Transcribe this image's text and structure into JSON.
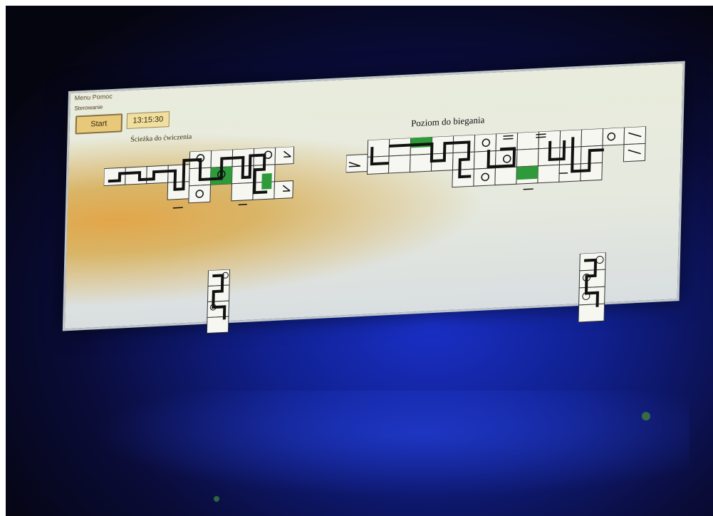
{
  "window": {
    "menu": "Menu Pomoc",
    "toolbar_label": "Sterowanie",
    "start_button": "Start",
    "timer": "13:15:30"
  },
  "practice": {
    "title": "Ścieżka do ćwiczenia"
  },
  "run": {
    "title": "Poziom do biegania"
  },
  "colors": {
    "tile": "#f7f7f2",
    "path": "#111111",
    "highlight": "#2f9a3a",
    "monitor_glow": "#1a30c8"
  },
  "icons": [
    "target-icon",
    "exit-arrow-icon",
    "stairs-icon",
    "ladder-icon",
    "conveyor-icon"
  ]
}
